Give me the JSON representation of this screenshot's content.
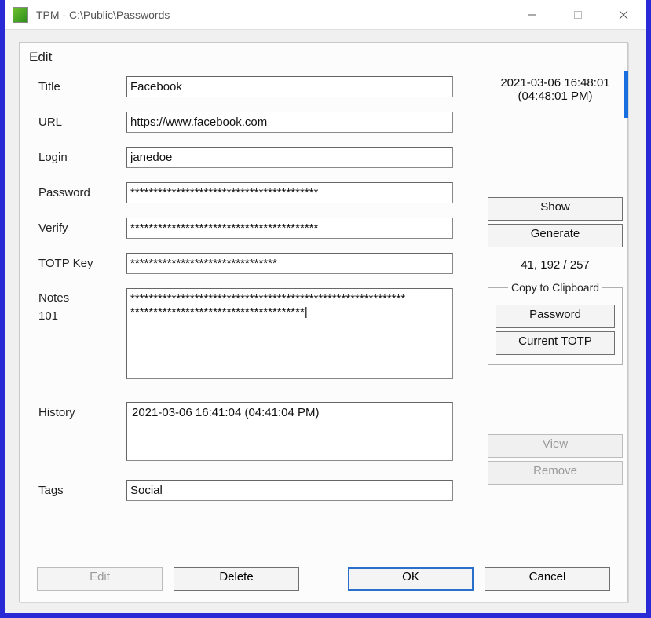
{
  "window": {
    "title": "TPM - C:\\Public\\Passwords"
  },
  "dialog": {
    "heading": "Edit",
    "timestamp_line1": "2021-03-06 16:48:01",
    "timestamp_line2": "(04:48:01 PM)",
    "labels": {
      "title": "Title",
      "url": "URL",
      "login": "Login",
      "password": "Password",
      "verify": "Verify",
      "totp": "TOTP Key",
      "notes": "Notes",
      "notes_count": "101",
      "history": "History",
      "tags": "Tags"
    },
    "fields": {
      "title": "Facebook",
      "url": "https://www.facebook.com",
      "login": "janedoe",
      "password": "*****************************************",
      "verify": "*****************************************",
      "totp": "********************************",
      "notes": "************************************************************\n**************************************|",
      "history_item": "2021-03-06 16:41:04 (04:41:04 PM)",
      "tags": "Social"
    },
    "buttons": {
      "show": "Show",
      "generate": "Generate",
      "counter": "41, 192 / 257",
      "copy_legend": "Copy to Clipboard",
      "copy_password": "Password",
      "copy_totp": "Current TOTP",
      "view": "View",
      "remove": "Remove",
      "edit": "Edit",
      "delete": "Delete",
      "ok": "OK",
      "cancel": "Cancel"
    }
  }
}
